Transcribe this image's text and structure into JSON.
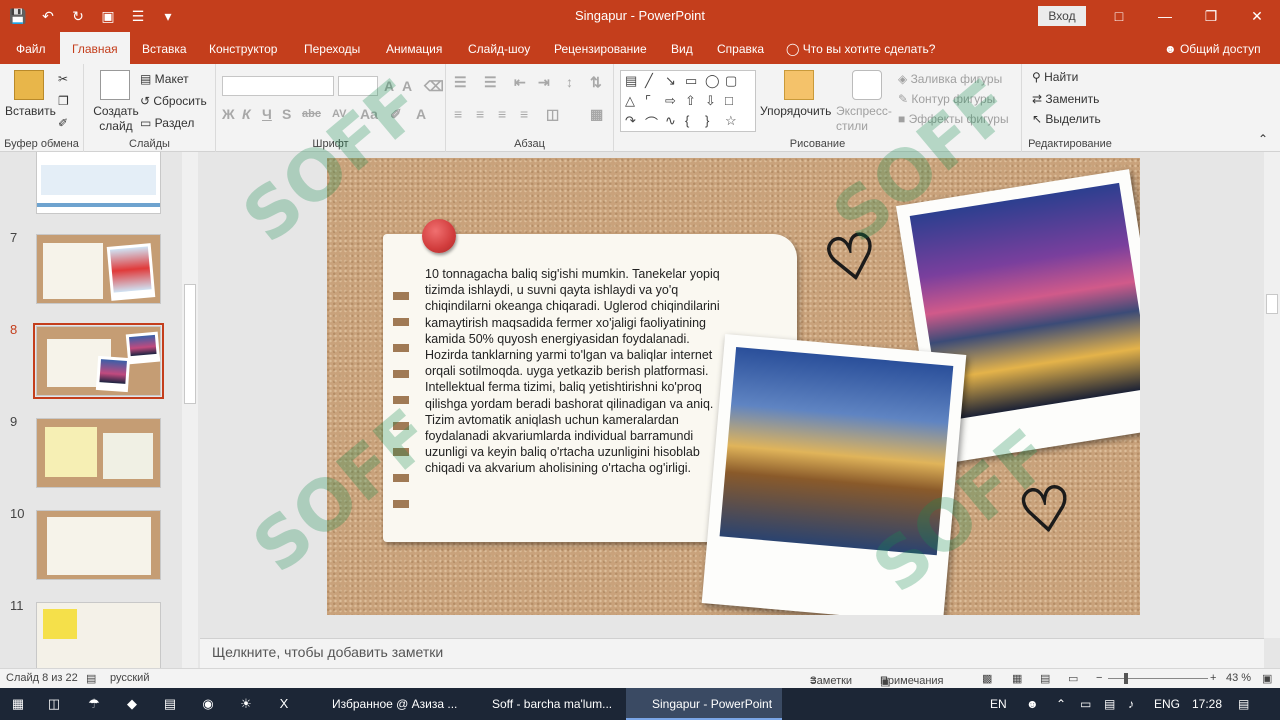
{
  "titlebar": {
    "title": "Singapur  -  PowerPoint",
    "signin": "Вход",
    "qat_icons": [
      "save-icon",
      "undo-icon",
      "redo-icon",
      "start-from-beginning-icon",
      "touch-mode-icon",
      "customize-icon"
    ]
  },
  "tabs": [
    "Файл",
    "Главная",
    "Вставка",
    "Конструктор",
    "Переходы",
    "Анимация",
    "Слайд-шоу",
    "Рецензирование",
    "Вид",
    "Справка"
  ],
  "active_tab": "Главная",
  "tellme": "Что вы хотите сделать?",
  "share": "Общий доступ",
  "ribbon": {
    "clipboard": {
      "paste": "Вставить",
      "label": "Буфер обмена"
    },
    "slides": {
      "new_slide": "Создать слайд",
      "layout": "Макет",
      "reset": "Сбросить",
      "section": "Раздел",
      "label": "Слайды"
    },
    "font": {
      "label": "Шрифт",
      "glyphs": [
        "Ж",
        "К",
        "Ч",
        "S",
        "abc",
        "AV",
        "Aa",
        "A"
      ]
    },
    "paragraph": {
      "label": "Абзац"
    },
    "drawing": {
      "arrange": "Упорядочить",
      "quick_styles": "Экспресс-стили",
      "fill": "Заливка фигуры",
      "outline": "Контур фигуры",
      "effects": "Эффекты фигуры",
      "label": "Рисование"
    },
    "editing": {
      "find": "Найти",
      "replace": "Заменить",
      "select": "Выделить",
      "label": "Редактирование"
    }
  },
  "thumbnails": [
    "7",
    "8",
    "9",
    "10",
    "11"
  ],
  "selected_slide": "8",
  "slide": {
    "text": "10 tonnagacha baliq sig'ishi mumkin. Tanekelar yopiq tizimda ishlaydi, u suvni qayta ishlaydi va yo'q chiqindilarni okeanga chiqaradi. Uglerod chiqindilarini kamaytirish maqsadida fermer xo'jaligi faoliyatining kamida 50% quyosh energiyasidan foydalanadi. Hozirda tanklarning yarmi to'lgan va baliqlar internet orqali sotilmoqda. uyga yetkazib berish platformasi. Intellektual ferma tizimi, baliq yetishtirishni ko'proq qilishga yordam beradi bashorat qilinadigan va aniq. Tizim avtomatik aniqlash uchun kameralardan foydalanadi akvariumlarda individual barramundi uzunligi va keyin baliq o'rtacha uzunligini hisoblab chiqadi va akvarium aholisining o'rtacha og'irligi."
  },
  "notes_placeholder": "Щелкните, чтобы добавить заметки",
  "status": {
    "slide_count": "Слайд 8 из 22",
    "language": "русский",
    "notes": "Заметки",
    "comments": "Примечания",
    "zoom": "43 %"
  },
  "taskbar": {
    "apps": [
      "Избранное @ Азиза ...",
      "Soff - barcha ma'lum...",
      "Singapur - PowerPoint"
    ],
    "lang1": "EN",
    "lang2": "ENG",
    "time": "17:28"
  },
  "watermark": "SOFF",
  "colors": {
    "accent": "#c43e1c",
    "taskbar": "#1c2636",
    "cork": "#c9a27b",
    "pin": "#d13c3c"
  }
}
